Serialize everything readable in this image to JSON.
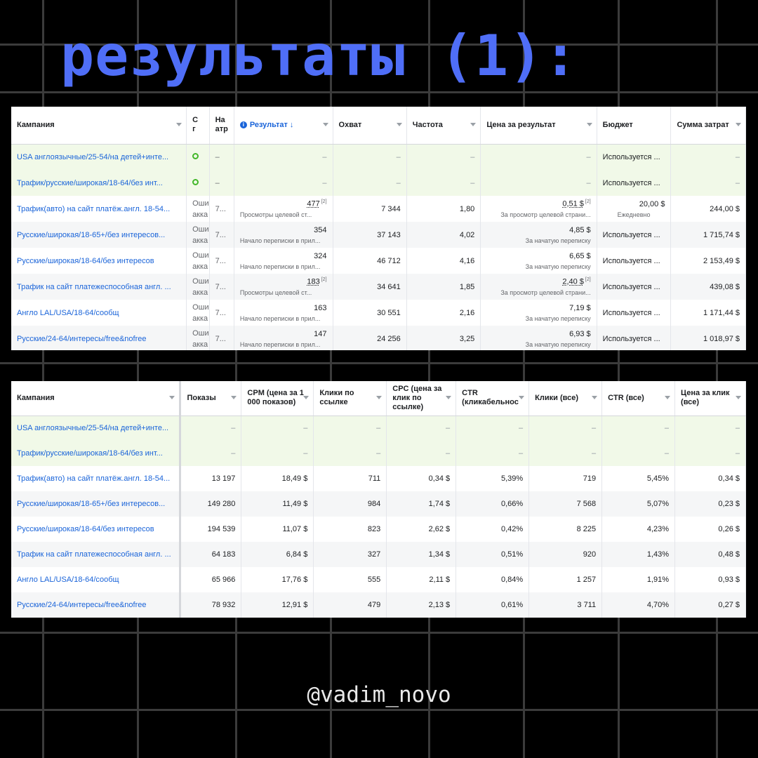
{
  "title": "результаты (1):",
  "handle": "@vadim_novo",
  "table1": {
    "headers": {
      "campaign": "Кампания",
      "status": "С г",
      "attr": "На атр",
      "result": "Результат ↓",
      "reach": "Охват",
      "freq": "Частота",
      "cpr": "Цена за результат",
      "budget": "Бюджет",
      "spent": "Сумма затрат"
    },
    "rows": [
      {
        "name": "USA англоязычные/25-54/на детей+инте...",
        "status": "",
        "attr": "–",
        "result": "–",
        "result_sub": "",
        "reach": "–",
        "freq": "–",
        "cpr": "–",
        "cpr_sub": "",
        "budget": "Используется ...",
        "budget_sub": "",
        "spent": "–"
      },
      {
        "name": "Трафик/русские/широкая/18-64/без инт...",
        "status": "",
        "attr": "–",
        "result": "–",
        "result_sub": "",
        "reach": "–",
        "freq": "–",
        "cpr": "–",
        "cpr_sub": "",
        "budget": "Используется ...",
        "budget_sub": "",
        "spent": "–"
      },
      {
        "name": "Трафик(авто) на сайт платёж.англ. 18-54...",
        "status": "Оши акка",
        "attr": "7...",
        "result": "477",
        "result_sub": "Просмотры целевой ст...",
        "reach": "7 344",
        "freq": "1,80",
        "cpr": "0,51 $",
        "cpr_sub": "За просмотр целевой страни...",
        "budget": "20,00 $",
        "budget_sub": "Ежедневно",
        "spent": "244,00 $"
      },
      {
        "name": "Русские/широкая/18-65+/без интересов...",
        "status": "Оши акка",
        "attr": "7...",
        "result": "354",
        "result_sub": "Начало переписки в прил...",
        "reach": "37 143",
        "freq": "4,02",
        "cpr": "4,85 $",
        "cpr_sub": "За начатую переписку",
        "budget": "Используется ...",
        "budget_sub": "",
        "spent": "1 715,74 $"
      },
      {
        "name": "Русские/широкая/18-64/без интересов",
        "status": "Оши акка",
        "attr": "7...",
        "result": "324",
        "result_sub": "Начало переписки в прил...",
        "reach": "46 712",
        "freq": "4,16",
        "cpr": "6,65 $",
        "cpr_sub": "За начатую переписку",
        "budget": "Используется ...",
        "budget_sub": "",
        "spent": "2 153,49 $"
      },
      {
        "name": "Трафик на сайт платежеспособная англ. ...",
        "status": "Оши акка",
        "attr": "7...",
        "result": "183",
        "result_sub": "Просмотры целевой ст...",
        "reach": "34 641",
        "freq": "1,85",
        "cpr": "2,40 $",
        "cpr_sub": "За просмотр целевой страни...",
        "budget": "Используется ...",
        "budget_sub": "",
        "spent": "439,08 $"
      },
      {
        "name": "Англо LAL/USA/18-64/сообщ",
        "status": "Оши акка",
        "attr": "7...",
        "result": "163",
        "result_sub": "Начало переписки в прил...",
        "reach": "30 551",
        "freq": "2,16",
        "cpr": "7,19 $",
        "cpr_sub": "За начатую переписку",
        "budget": "Используется ...",
        "budget_sub": "",
        "spent": "1 171,44 $"
      },
      {
        "name": "Русские/24-64/интересы/free&nofree",
        "status": "Оши акка",
        "attr": "7...",
        "result": "147",
        "result_sub": "Начало переписки в прил...",
        "reach": "24 256",
        "freq": "3,25",
        "cpr": "6,93 $",
        "cpr_sub": "За начатую переписку",
        "budget": "Используется ...",
        "budget_sub": "",
        "spent": "1 018,97 $"
      }
    ]
  },
  "table2": {
    "headers": {
      "campaign": "Кампания",
      "impr": "Показы",
      "cpm": "CPM (цена за 1 000 показов)",
      "clicks_link": "Клики по ссылке",
      "cpc": "CPC (цена за клик по ссылке)",
      "ctr": "CTR (кликабельнос",
      "clicks_all": "Клики (все)",
      "ctr_all": "CTR (все)",
      "cpc_all": "Цена за клик (все)"
    },
    "rows": [
      {
        "name": "USA англоязычные/25-54/на детей+инте...",
        "impr": "–",
        "cpm": "–",
        "clicks_link": "–",
        "cpc": "–",
        "ctr": "–",
        "clicks_all": "–",
        "ctr_all": "–",
        "cpc_all": "–"
      },
      {
        "name": "Трафик/русские/широкая/18-64/без инт...",
        "impr": "–",
        "cpm": "–",
        "clicks_link": "–",
        "cpc": "–",
        "ctr": "–",
        "clicks_all": "–",
        "ctr_all": "–",
        "cpc_all": "–"
      },
      {
        "name": "Трафик(авто) на сайт платёж.англ. 18-54...",
        "impr": "13 197",
        "cpm": "18,49 $",
        "clicks_link": "711",
        "cpc": "0,34 $",
        "ctr": "5,39%",
        "clicks_all": "719",
        "ctr_all": "5,45%",
        "cpc_all": "0,34 $"
      },
      {
        "name": "Русские/широкая/18-65+/без интересов...",
        "impr": "149 280",
        "cpm": "11,49 $",
        "clicks_link": "984",
        "cpc": "1,74 $",
        "ctr": "0,66%",
        "clicks_all": "7 568",
        "ctr_all": "5,07%",
        "cpc_all": "0,23 $"
      },
      {
        "name": "Русские/широкая/18-64/без интересов",
        "impr": "194 539",
        "cpm": "11,07 $",
        "clicks_link": "823",
        "cpc": "2,62 $",
        "ctr": "0,42%",
        "clicks_all": "8 225",
        "ctr_all": "4,23%",
        "cpc_all": "0,26 $"
      },
      {
        "name": "Трафик на сайт платежеспособная англ. ...",
        "impr": "64 183",
        "cpm": "6,84 $",
        "clicks_link": "327",
        "cpc": "1,34 $",
        "ctr": "0,51%",
        "clicks_all": "920",
        "ctr_all": "1,43%",
        "cpc_all": "0,48 $"
      },
      {
        "name": "Англо LAL/USA/18-64/сообщ",
        "impr": "65 966",
        "cpm": "17,76 $",
        "clicks_link": "555",
        "cpc": "2,11 $",
        "ctr": "0,84%",
        "clicks_all": "1 257",
        "ctr_all": "1,91%",
        "cpc_all": "0,93 $"
      },
      {
        "name": "Русские/24-64/интересы/free&nofree",
        "impr": "78 932",
        "cpm": "12,91 $",
        "clicks_link": "479",
        "cpc": "2,13 $",
        "ctr": "0,61%",
        "clicks_all": "3 711",
        "ctr_all": "4,70%",
        "cpc_all": "0,27 $"
      }
    ]
  }
}
